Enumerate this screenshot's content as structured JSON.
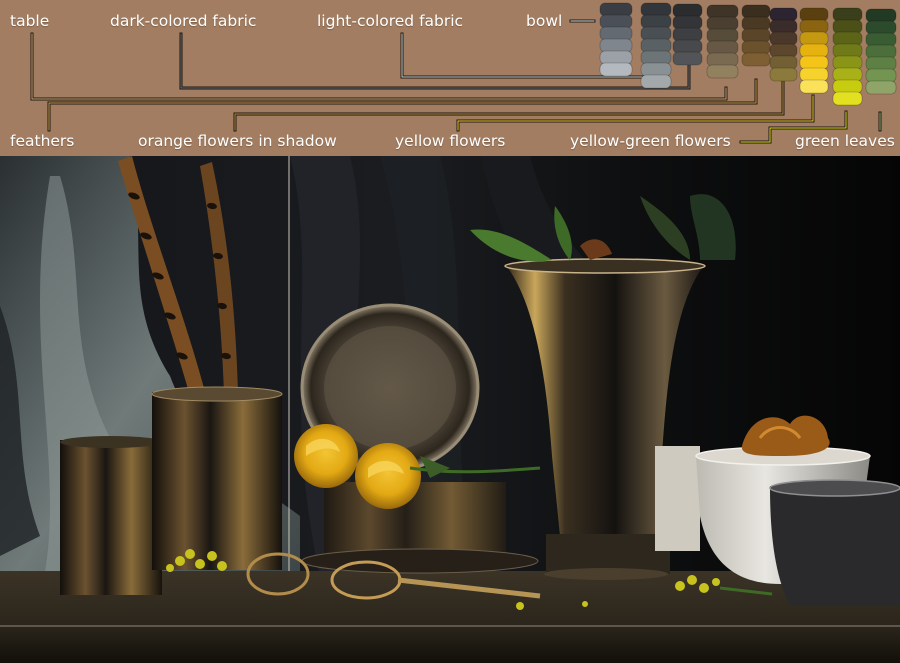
{
  "legend": {
    "background": "#a27d61",
    "labels": {
      "table": "table",
      "dark_fabric": "dark-colored fabric",
      "light_fabric": "light-colored fabric",
      "bowl": "bowl",
      "feathers": "feathers",
      "orange_shadow": "orange flowers in shadow",
      "yellow_flowers": "yellow flowers",
      "yellow_green": "yellow-green flowers",
      "green_leaves": "green leaves"
    },
    "palette": [
      {
        "name": "bowl",
        "colors": [
          "#3a3d44",
          "#4b5058",
          "#646a72",
          "#80868d",
          "#9ba1a7",
          "#b3b9bf"
        ]
      },
      {
        "name": "light-colored fabric",
        "colors": [
          "#32363a",
          "#3c4145",
          "#494f53",
          "#5a6165",
          "#6c7478",
          "#8a9194",
          "#a3a9aa"
        ]
      },
      {
        "name": "dark-colored fabric",
        "colors": [
          "#2b2c2e",
          "#343538",
          "#3d3f42",
          "#47494c",
          "#525457"
        ]
      },
      {
        "name": "table",
        "colors": [
          "#3e3528",
          "#4a3f30",
          "#574b39",
          "#665844",
          "#7a6a52",
          "#92815f"
        ]
      },
      {
        "name": "feathers",
        "colors": [
          "#3a2e1e",
          "#4a3a24",
          "#5a4528",
          "#6b522d",
          "#7d5f33"
        ]
      },
      {
        "name": "orange flowers in shadow",
        "colors": [
          "#2c2430",
          "#3a2c2a",
          "#4a382a",
          "#5c462c",
          "#726034",
          "#8c7a3c"
        ]
      },
      {
        "name": "yellow flowers",
        "colors": [
          "#5a4010",
          "#8a6410",
          "#c49810",
          "#e6b210",
          "#f4c418",
          "#f8d22c",
          "#fbe15a"
        ]
      },
      {
        "name": "yellow-green flowers",
        "colors": [
          "#3a3e1a",
          "#4a5018",
          "#5c6418",
          "#707a18",
          "#8a9418",
          "#a8b218",
          "#c8cc10",
          "#e2e020"
        ]
      },
      {
        "name": "green leaves",
        "colors": [
          "#223a24",
          "#2c4a2c",
          "#3a5c32",
          "#4b6e3a",
          "#5e8044",
          "#749452",
          "#8ea468"
        ]
      }
    ]
  }
}
